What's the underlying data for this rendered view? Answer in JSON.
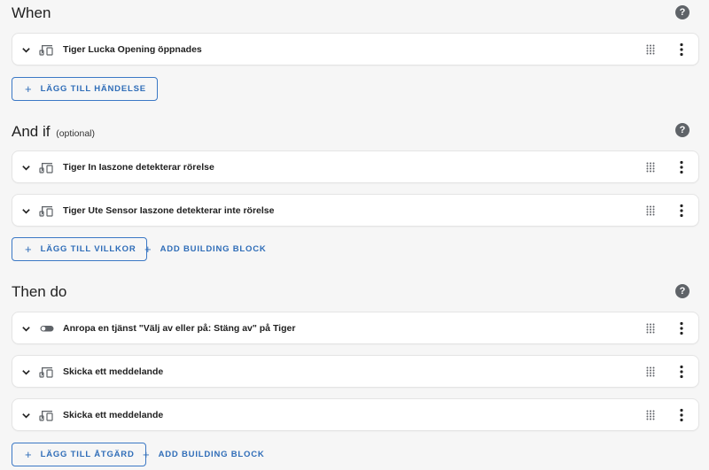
{
  "sections": {
    "triggers": {
      "title": "When",
      "items": [
        {
          "label": "Tiger Lucka Opening öppnades",
          "icon": "device-icon"
        }
      ],
      "add_label": "LÄGG TILL HÄNDELSE"
    },
    "conditions": {
      "title": "And if",
      "optional": "(optional)",
      "items": [
        {
          "label": "Tiger In Iaszone detekterar rörelse",
          "icon": "device-icon"
        },
        {
          "label": "Tiger Ute Sensor Iaszone detekterar inte rörelse",
          "icon": "device-icon"
        }
      ],
      "add_label": "LÄGG TILL VILLKOR",
      "building_block_label": "ADD BUILDING BLOCK"
    },
    "actions": {
      "title": "Then do",
      "items": [
        {
          "label": "Anropa en tjänst \"Välj av eller på: Stäng av\" på Tiger",
          "icon": "toggle-icon"
        },
        {
          "label": "Skicka ett meddelande",
          "icon": "device-icon"
        },
        {
          "label": "Skicka ett meddelande",
          "icon": "device-icon"
        }
      ],
      "add_label": "LÄGG TILL ÅTGÄRD",
      "building_block_label": "ADD BUILDING BLOCK"
    }
  },
  "help_icon": "?",
  "colors": {
    "background": "#f6f6f6",
    "card": "#ffffff",
    "accent": "#2f6db8",
    "text": "#212121",
    "icon": "#5f6368"
  }
}
